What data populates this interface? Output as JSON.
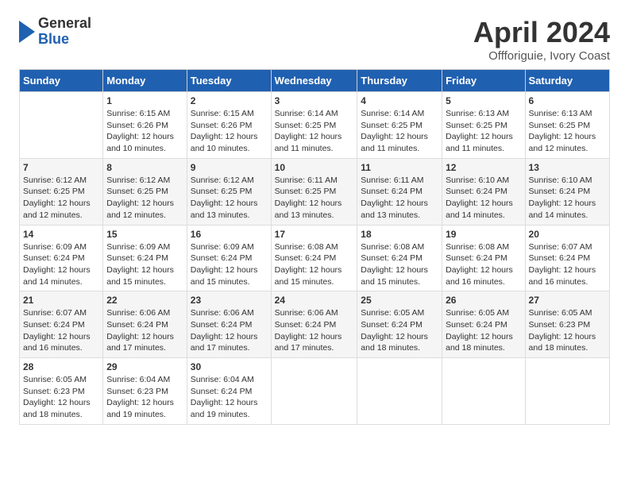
{
  "logo": {
    "general": "General",
    "blue": "Blue"
  },
  "title": "April 2024",
  "subtitle": "Offforiguie, Ivory Coast",
  "days_of_week": [
    "Sunday",
    "Monday",
    "Tuesday",
    "Wednesday",
    "Thursday",
    "Friday",
    "Saturday"
  ],
  "weeks": [
    [
      {
        "day": "",
        "lines": []
      },
      {
        "day": "1",
        "lines": [
          "Sunrise: 6:15 AM",
          "Sunset: 6:26 PM",
          "Daylight: 12 hours",
          "and 10 minutes."
        ]
      },
      {
        "day": "2",
        "lines": [
          "Sunrise: 6:15 AM",
          "Sunset: 6:26 PM",
          "Daylight: 12 hours",
          "and 10 minutes."
        ]
      },
      {
        "day": "3",
        "lines": [
          "Sunrise: 6:14 AM",
          "Sunset: 6:25 PM",
          "Daylight: 12 hours",
          "and 11 minutes."
        ]
      },
      {
        "day": "4",
        "lines": [
          "Sunrise: 6:14 AM",
          "Sunset: 6:25 PM",
          "Daylight: 12 hours",
          "and 11 minutes."
        ]
      },
      {
        "day": "5",
        "lines": [
          "Sunrise: 6:13 AM",
          "Sunset: 6:25 PM",
          "Daylight: 12 hours",
          "and 11 minutes."
        ]
      },
      {
        "day": "6",
        "lines": [
          "Sunrise: 6:13 AM",
          "Sunset: 6:25 PM",
          "Daylight: 12 hours",
          "and 12 minutes."
        ]
      }
    ],
    [
      {
        "day": "7",
        "lines": [
          "Sunrise: 6:12 AM",
          "Sunset: 6:25 PM",
          "Daylight: 12 hours",
          "and 12 minutes."
        ]
      },
      {
        "day": "8",
        "lines": [
          "Sunrise: 6:12 AM",
          "Sunset: 6:25 PM",
          "Daylight: 12 hours",
          "and 12 minutes."
        ]
      },
      {
        "day": "9",
        "lines": [
          "Sunrise: 6:12 AM",
          "Sunset: 6:25 PM",
          "Daylight: 12 hours",
          "and 13 minutes."
        ]
      },
      {
        "day": "10",
        "lines": [
          "Sunrise: 6:11 AM",
          "Sunset: 6:25 PM",
          "Daylight: 12 hours",
          "and 13 minutes."
        ]
      },
      {
        "day": "11",
        "lines": [
          "Sunrise: 6:11 AM",
          "Sunset: 6:24 PM",
          "Daylight: 12 hours",
          "and 13 minutes."
        ]
      },
      {
        "day": "12",
        "lines": [
          "Sunrise: 6:10 AM",
          "Sunset: 6:24 PM",
          "Daylight: 12 hours",
          "and 14 minutes."
        ]
      },
      {
        "day": "13",
        "lines": [
          "Sunrise: 6:10 AM",
          "Sunset: 6:24 PM",
          "Daylight: 12 hours",
          "and 14 minutes."
        ]
      }
    ],
    [
      {
        "day": "14",
        "lines": [
          "Sunrise: 6:09 AM",
          "Sunset: 6:24 PM",
          "Daylight: 12 hours",
          "and 14 minutes."
        ]
      },
      {
        "day": "15",
        "lines": [
          "Sunrise: 6:09 AM",
          "Sunset: 6:24 PM",
          "Daylight: 12 hours",
          "and 15 minutes."
        ]
      },
      {
        "day": "16",
        "lines": [
          "Sunrise: 6:09 AM",
          "Sunset: 6:24 PM",
          "Daylight: 12 hours",
          "and 15 minutes."
        ]
      },
      {
        "day": "17",
        "lines": [
          "Sunrise: 6:08 AM",
          "Sunset: 6:24 PM",
          "Daylight: 12 hours",
          "and 15 minutes."
        ]
      },
      {
        "day": "18",
        "lines": [
          "Sunrise: 6:08 AM",
          "Sunset: 6:24 PM",
          "Daylight: 12 hours",
          "and 15 minutes."
        ]
      },
      {
        "day": "19",
        "lines": [
          "Sunrise: 6:08 AM",
          "Sunset: 6:24 PM",
          "Daylight: 12 hours",
          "and 16 minutes."
        ]
      },
      {
        "day": "20",
        "lines": [
          "Sunrise: 6:07 AM",
          "Sunset: 6:24 PM",
          "Daylight: 12 hours",
          "and 16 minutes."
        ]
      }
    ],
    [
      {
        "day": "21",
        "lines": [
          "Sunrise: 6:07 AM",
          "Sunset: 6:24 PM",
          "Daylight: 12 hours",
          "and 16 minutes."
        ]
      },
      {
        "day": "22",
        "lines": [
          "Sunrise: 6:06 AM",
          "Sunset: 6:24 PM",
          "Daylight: 12 hours",
          "and 17 minutes."
        ]
      },
      {
        "day": "23",
        "lines": [
          "Sunrise: 6:06 AM",
          "Sunset: 6:24 PM",
          "Daylight: 12 hours",
          "and 17 minutes."
        ]
      },
      {
        "day": "24",
        "lines": [
          "Sunrise: 6:06 AM",
          "Sunset: 6:24 PM",
          "Daylight: 12 hours",
          "and 17 minutes."
        ]
      },
      {
        "day": "25",
        "lines": [
          "Sunrise: 6:05 AM",
          "Sunset: 6:24 PM",
          "Daylight: 12 hours",
          "and 18 minutes."
        ]
      },
      {
        "day": "26",
        "lines": [
          "Sunrise: 6:05 AM",
          "Sunset: 6:24 PM",
          "Daylight: 12 hours",
          "and 18 minutes."
        ]
      },
      {
        "day": "27",
        "lines": [
          "Sunrise: 6:05 AM",
          "Sunset: 6:23 PM",
          "Daylight: 12 hours",
          "and 18 minutes."
        ]
      }
    ],
    [
      {
        "day": "28",
        "lines": [
          "Sunrise: 6:05 AM",
          "Sunset: 6:23 PM",
          "Daylight: 12 hours",
          "and 18 minutes."
        ]
      },
      {
        "day": "29",
        "lines": [
          "Sunrise: 6:04 AM",
          "Sunset: 6:23 PM",
          "Daylight: 12 hours",
          "and 19 minutes."
        ]
      },
      {
        "day": "30",
        "lines": [
          "Sunrise: 6:04 AM",
          "Sunset: 6:24 PM",
          "Daylight: 12 hours",
          "and 19 minutes."
        ]
      },
      {
        "day": "",
        "lines": []
      },
      {
        "day": "",
        "lines": []
      },
      {
        "day": "",
        "lines": []
      },
      {
        "day": "",
        "lines": []
      }
    ]
  ]
}
